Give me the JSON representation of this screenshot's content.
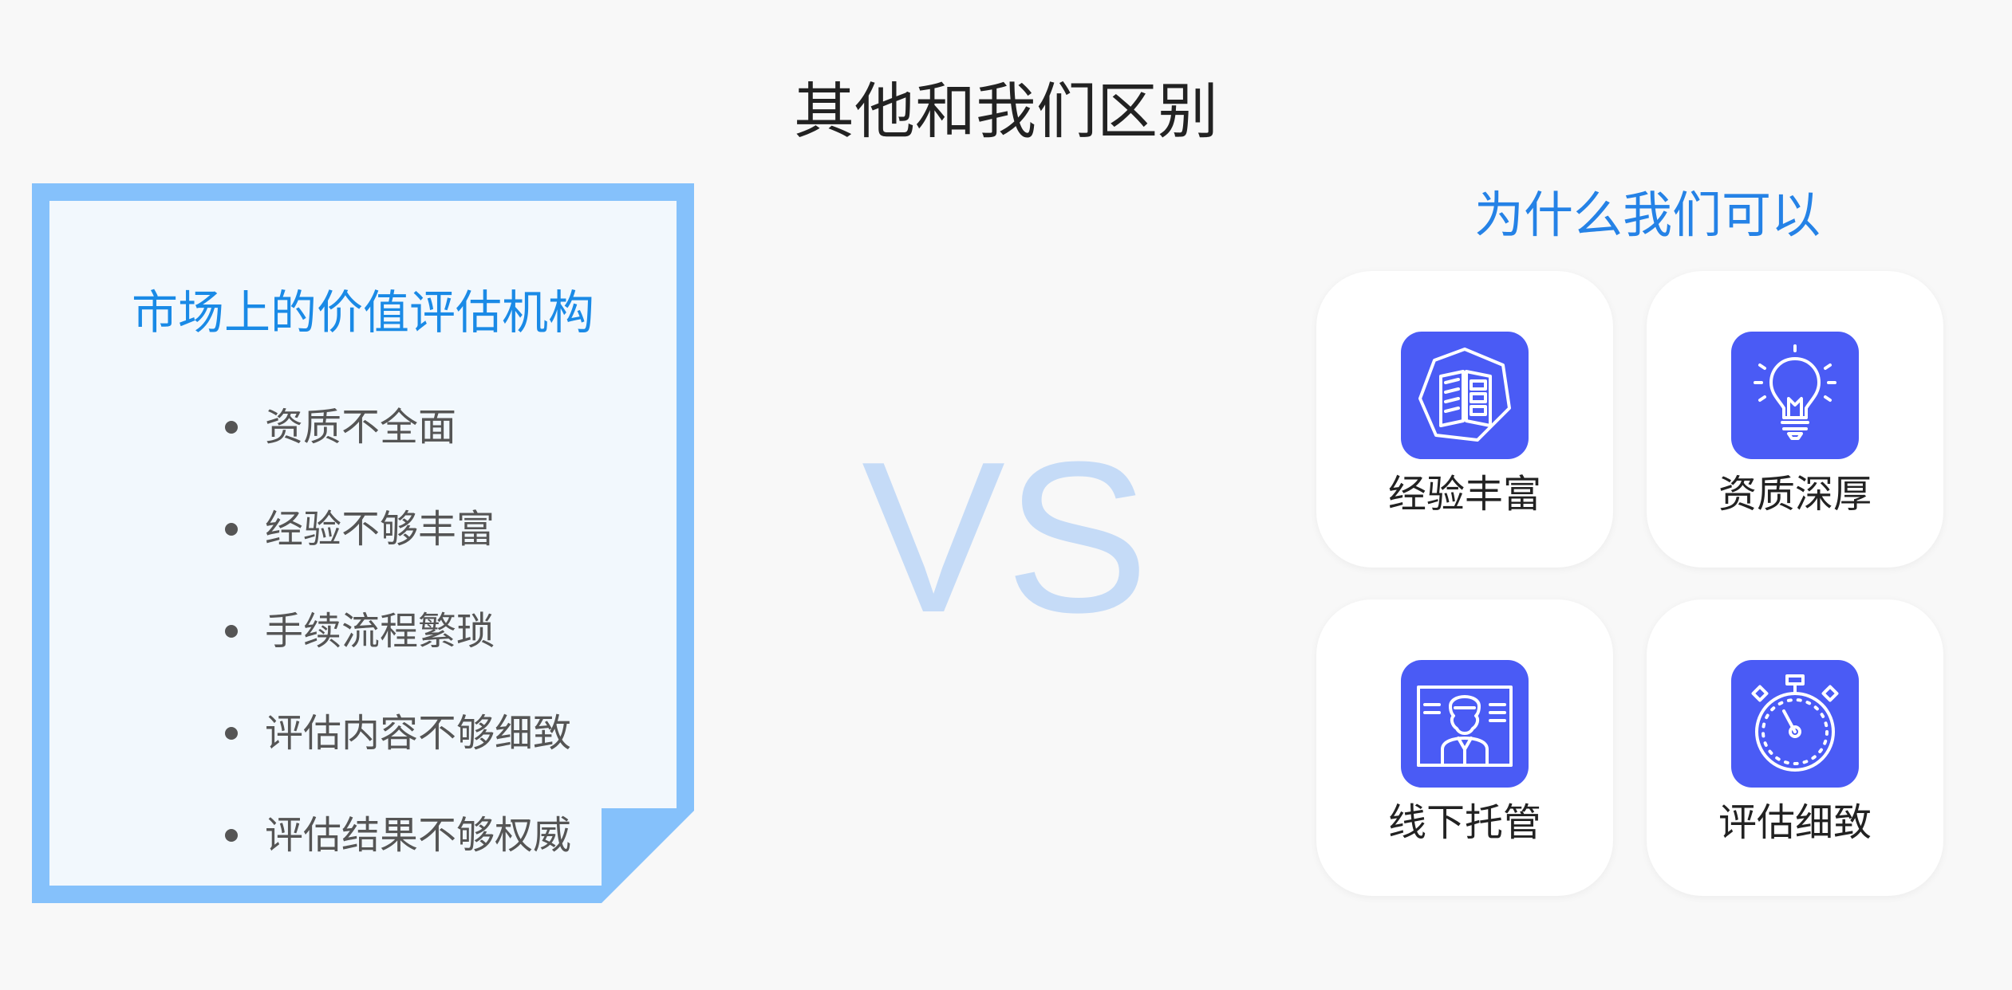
{
  "page": {
    "title": "其他和我们区别"
  },
  "left_card": {
    "heading": "市场上的价值评估机构",
    "items": [
      "资质不全面",
      "经验不够丰富",
      "手续流程繁琐",
      "评估内容不够细致",
      "评估结果不够权威"
    ],
    "border_color": "#85c1fb",
    "background_color": "#f2f8fd"
  },
  "vs": {
    "text": "VS",
    "color": "#c5dbf7"
  },
  "right_section": {
    "heading": "为什么我们可以",
    "accent_color": "#4a5bf5",
    "tiles": [
      {
        "label": "经验丰富",
        "icon": "book-icon"
      },
      {
        "label": "资质深厚",
        "icon": "lightbulb-icon"
      },
      {
        "label": "线下托管",
        "icon": "consultant-icon"
      },
      {
        "label": "评估细致",
        "icon": "stopwatch-icon"
      }
    ]
  }
}
